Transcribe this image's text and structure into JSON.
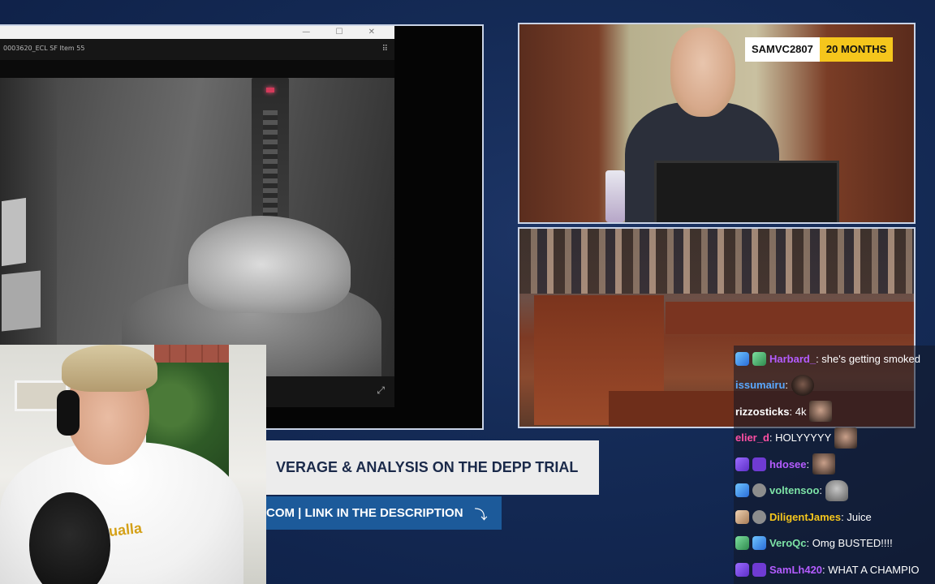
{
  "screen_share": {
    "window_title": "0003620_ECL SF Item 55",
    "titlebar_controls": "— ☐ ✕",
    "grid_icon": "⠿",
    "expand_icon": "⤢"
  },
  "court_feed": {
    "sub_badge": {
      "username": "SAMVC2807",
      "months": "20 MONTHS",
      "accent": "#f5c61c"
    }
  },
  "banner": {
    "headline": "VERAGE & ANALYSIS ON THE DEPP TRIAL",
    "link_text": "COM | LINK IN THE DESCRIPTION",
    "arrow": "⤵",
    "link_bg": "#1c5a9a"
  },
  "webcam": {
    "hoodie_text": "ualla"
  },
  "chat": {
    "messages": [
      {
        "user": "Harbard_",
        "color": "#b45cff",
        "text": ": she's getting smoked",
        "badges": [
          "b-blue",
          "b-green"
        ]
      },
      {
        "user": "issumairu",
        "color": "#5aa8ff",
        "text": ":",
        "badges": [],
        "emote": "dark"
      },
      {
        "user": "rizzosticks",
        "color": "#ffffff",
        "text": ": 4k",
        "badges": [],
        "emote": "face"
      },
      {
        "user": "elier_d",
        "color": "#ff4fa3",
        "text": ": HOLYYYYY",
        "badges": [],
        "emote": "face"
      },
      {
        "user": "hdosee",
        "color": "#b45cff",
        "text": ":",
        "badges": [
          "b-purple",
          "b-star"
        ],
        "emote": "face"
      },
      {
        "user": "voltensoo",
        "color": "#7de3a6",
        "text": ":",
        "badges": [
          "b-blue",
          "b-gray"
        ],
        "emote": "ghost"
      },
      {
        "user": "DiligentJames",
        "color": "#f5c61c",
        "text": ": Juice",
        "badges": [
          "b-tan",
          "b-gray"
        ]
      },
      {
        "user": "VeroQc",
        "color": "#7de3a6",
        "text": ": Omg BUSTED!!!!",
        "badges": [
          "b-green",
          "b-blue"
        ]
      },
      {
        "user": "SamLh420",
        "color": "#b45cff",
        "text": ": WHAT A CHAMPIO",
        "badges": [
          "b-purple",
          "b-star"
        ]
      }
    ]
  }
}
